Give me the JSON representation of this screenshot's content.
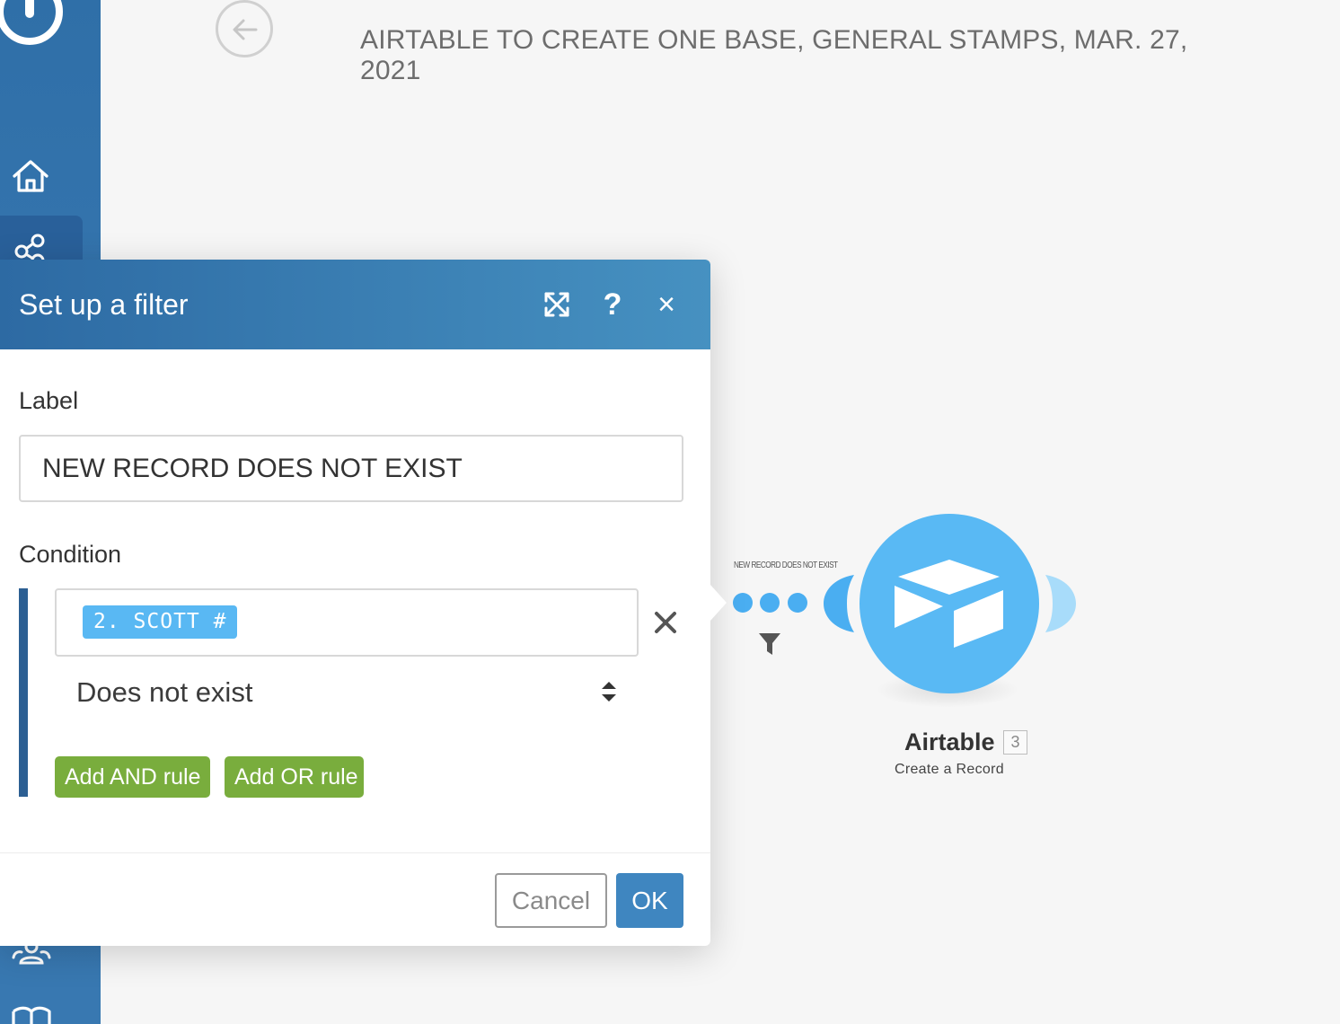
{
  "scenario": {
    "title": "AIRTABLE TO CREATE ONE BASE, GENERAL STAMPS, MAR. 27, 2021"
  },
  "sidebar": {
    "items": [
      {
        "icon": "home-icon"
      },
      {
        "icon": "share-nodes-icon"
      },
      {
        "icon": "team-icon"
      },
      {
        "icon": "book-icon"
      }
    ],
    "accent": "#2f6fa8"
  },
  "dialog": {
    "title": "Set up a filter",
    "header_icons": [
      "expand-icon",
      "help-icon",
      "close-icon"
    ],
    "help_glyph": "?",
    "close_glyph": "×",
    "label_field": {
      "label": "Label",
      "value": "NEW RECORD DOES NOT EXIST"
    },
    "condition": {
      "label": "Condition",
      "operand_pill": "2. SCOTT #",
      "operator": "Does not exist"
    },
    "buttons": {
      "add_and": "Add AND rule",
      "add_or": "Add OR rule",
      "cancel": "Cancel",
      "ok": "OK"
    },
    "colors": {
      "header": "#2d6aa3",
      "pill": "#59b8f3",
      "green_button": "#79ad3d",
      "ok_button": "#3f86c0"
    }
  },
  "route": {
    "label": "NEW RECORD DOES NOT EXIST"
  },
  "module": {
    "name": "Airtable",
    "badge": "3",
    "action": "Create a Record",
    "color": "#59b9f4"
  }
}
